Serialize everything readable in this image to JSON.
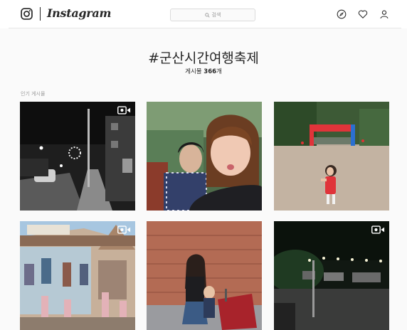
{
  "header": {
    "logo_text": "Instagram",
    "search": {
      "placeholder": "검색",
      "icon": "search-icon"
    },
    "nav_icons": [
      "compass-icon",
      "heart-icon",
      "user-icon"
    ]
  },
  "tag": {
    "title": "#군산시간여행축제",
    "count_prefix": "게시물 ",
    "count_value": "366",
    "count_suffix": "개"
  },
  "section": {
    "label": "인기 게시물"
  },
  "posts": [
    {
      "alt": "night street photo",
      "video": true
    },
    {
      "alt": "couple selfie",
      "video": false
    },
    {
      "alt": "child at festival gate",
      "video": false
    },
    {
      "alt": "building facade mural",
      "video": true
    },
    {
      "alt": "family by brick wall",
      "video": false
    },
    {
      "alt": "night lights street",
      "video": true
    }
  ],
  "colors": {
    "text": "#262626",
    "muted": "#999999",
    "border": "#dbdbdb",
    "background": "#fafafa"
  }
}
